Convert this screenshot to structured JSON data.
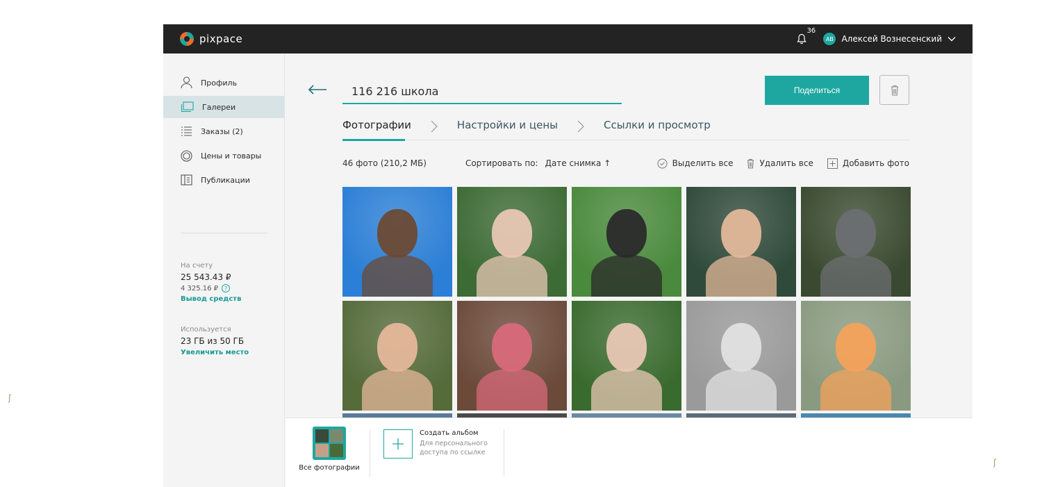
{
  "app": {
    "logo_text": "pixpace"
  },
  "topbar": {
    "notifications_count": "36",
    "user_initials": "AB",
    "user_name": "Алексей Вознесенский"
  },
  "sidebar": {
    "items": [
      {
        "label": "Профиль",
        "icon": "user-icon"
      },
      {
        "label": "Галереи",
        "icon": "gallery-icon",
        "active": true
      },
      {
        "label": "Заказы (2)",
        "icon": "list-icon"
      },
      {
        "label": "Цены и товары",
        "icon": "circle-icon"
      },
      {
        "label": "Публикации",
        "icon": "publication-icon"
      }
    ],
    "balance": {
      "label": "На счету",
      "amount": "25 543.43 ₽",
      "pending": "4 325.16 ₽",
      "withdraw_link": "Вывод средств"
    },
    "storage": {
      "label": "Используется",
      "amount": "23 ГБ из 50 ГБ",
      "increase_link": "Увеличить место"
    }
  },
  "main": {
    "gallery_title": "116 216 школа",
    "share_label": "Поделиться",
    "steps": [
      "Фотографии",
      "Настройки и цены",
      "Ссылки и просмотр"
    ],
    "photo_count": "46 фото (210,2 МБ)",
    "sort_label": "Сортировать по:",
    "sort_value": "Дате снимка ↑",
    "select_all": "Выделить все",
    "delete_all": "Удалить все",
    "add_photo": "Добавить фото"
  },
  "photos": [
    {
      "bg": "#2b7fd6",
      "fg": "#6b4a35"
    },
    {
      "bg": "#3d6b35",
      "fg": "#e8c7b4"
    },
    {
      "bg": "#4a8a3c",
      "fg": "#2a2a2a"
    },
    {
      "bg": "#2f4a3a",
      "fg": "#e3b89a"
    },
    {
      "bg": "#3a4a30",
      "fg": "#6b6f72"
    },
    {
      "bg": "#556b3a",
      "fg": "#e5b79a"
    },
    {
      "bg": "#6b4a3a",
      "fg": "#d86a7a"
    },
    {
      "bg": "#3a6b2e",
      "fg": "#e8c7b4"
    },
    {
      "bg": "#9a9a9a",
      "fg": "#e0e0e0"
    },
    {
      "bg": "#8a9a80",
      "fg": "#f4a25a"
    }
  ],
  "bottom": {
    "all_photos_label": "Все фотографии",
    "create_album_title": "Создать альбом",
    "create_album_sub": "Для персонального доступа по ссылке"
  }
}
